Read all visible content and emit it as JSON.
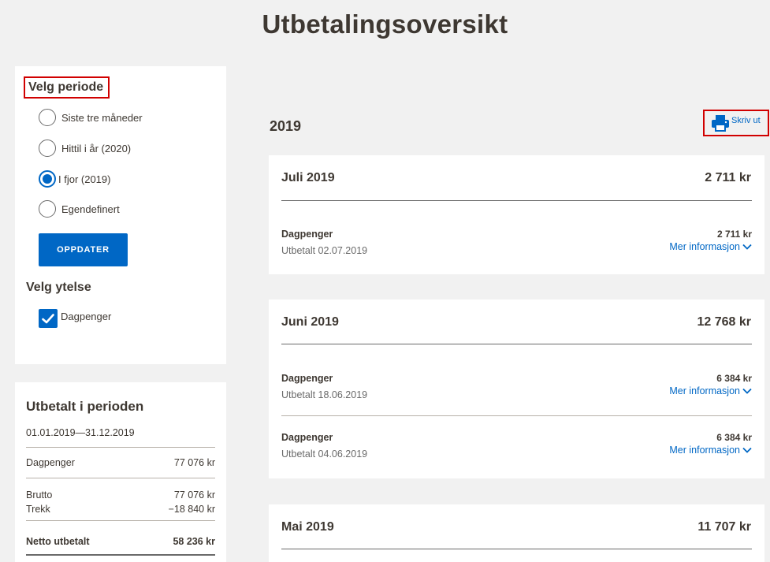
{
  "page": {
    "title": "Utbetalingsoversikt"
  },
  "filter": {
    "period_heading": "Velg periode",
    "options": [
      {
        "label": "Siste tre måneder",
        "checked": false
      },
      {
        "label": "Hittil i år (2020)",
        "checked": false
      },
      {
        "label": "I fjor (2019)",
        "checked": true
      },
      {
        "label": "Egendefinert",
        "checked": false
      }
    ],
    "update_button": "OPPDATER",
    "benefit_heading": "Velg ytelse",
    "benefit": {
      "label": "Dagpenger",
      "checked": true
    }
  },
  "summary": {
    "title": "Utbetalt i perioden",
    "date_range": "01.01.2019—31.12.2019",
    "benefit_label": "Dagpenger",
    "benefit_amount": "77 076 kr",
    "gross_label": "Brutto",
    "gross_amount": "77 076 kr",
    "deduction_label": "Trekk",
    "deduction_amount": "−18 840 kr",
    "net_label": "Netto utbetalt",
    "net_amount": "58 236 kr"
  },
  "year": {
    "title": "2019",
    "print_label": "Skriv ut"
  },
  "months": [
    {
      "name": "Juli 2019",
      "total": "2 711 kr",
      "items": [
        {
          "type": "Dagpenger",
          "date": "Utbetalt 02.07.2019",
          "amount": "2 711 kr",
          "more": "Mer informasjon"
        }
      ]
    },
    {
      "name": "Juni 2019",
      "total": "12 768 kr",
      "items": [
        {
          "type": "Dagpenger",
          "date": "Utbetalt 18.06.2019",
          "amount": "6 384 kr",
          "more": "Mer informasjon"
        },
        {
          "type": "Dagpenger",
          "date": "Utbetalt 04.06.2019",
          "amount": "6 384 kr",
          "more": "Mer informasjon"
        }
      ]
    },
    {
      "name": "Mai 2019",
      "total": "11 707 kr",
      "items": []
    }
  ],
  "colors": {
    "accent": "#0067c5",
    "highlight": "#d10000",
    "text": "#3e3832",
    "background": "#f1f1f1"
  }
}
